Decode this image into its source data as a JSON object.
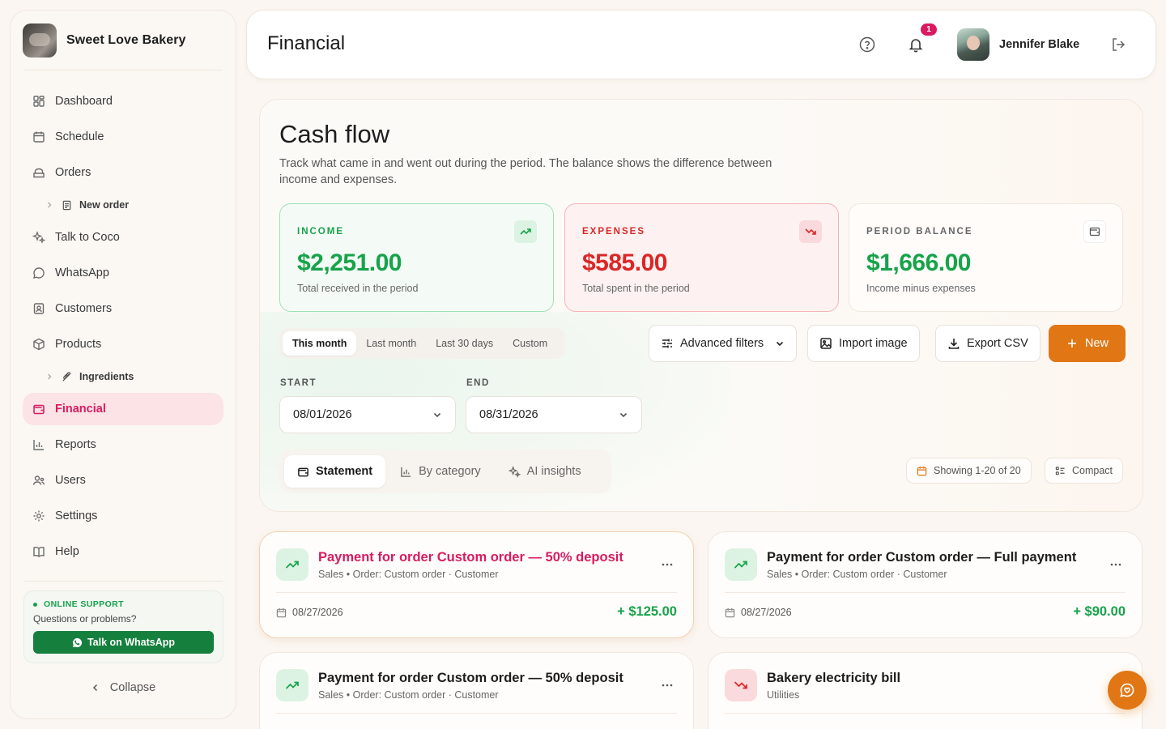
{
  "brand": {
    "name": "Sweet Love Bakery"
  },
  "sidebar": {
    "items": [
      {
        "label": "Dashboard",
        "icon": "dashboard-icon"
      },
      {
        "label": "Schedule",
        "icon": "calendar-icon"
      },
      {
        "label": "Orders",
        "icon": "orders-icon"
      },
      {
        "label": "New order",
        "icon": "document-icon",
        "sub": true
      },
      {
        "label": "Talk to Coco",
        "icon": "sparkles-icon"
      },
      {
        "label": "WhatsApp",
        "icon": "chat-bubble-icon"
      },
      {
        "label": "Customers",
        "icon": "contact-icon"
      },
      {
        "label": "Products",
        "icon": "box-icon"
      },
      {
        "label": "Ingredients",
        "icon": "wheat-icon",
        "sub": true
      },
      {
        "label": "Financial",
        "icon": "wallet-icon",
        "active": true
      },
      {
        "label": "Reports",
        "icon": "bar-chart-icon"
      },
      {
        "label": "Users",
        "icon": "users-icon"
      },
      {
        "label": "Settings",
        "icon": "gear-icon"
      },
      {
        "label": "Help",
        "icon": "book-icon"
      }
    ],
    "support": {
      "tag": "ONLINE SUPPORT",
      "question": "Questions or problems?",
      "button": "Talk on WhatsApp"
    },
    "collapse": "Collapse"
  },
  "header": {
    "title": "Financial",
    "notifications": "1",
    "user_name": "Jennifer Blake"
  },
  "cashflow": {
    "title": "Cash flow",
    "description": "Track what came in and went out during the period. The balance shows the difference between income and expenses.",
    "income": {
      "label": "INCOME",
      "value": "$2,251.00",
      "sub": "Total received in the period"
    },
    "expenses": {
      "label": "EXPENSES",
      "value": "$585.00",
      "sub": "Total spent in the period"
    },
    "balance": {
      "label": "PERIOD BALANCE",
      "value": "$1,666.00",
      "sub": "Income minus expenses"
    },
    "periods": [
      "This month",
      "Last month",
      "Last 30 days",
      "Custom"
    ],
    "active_period": "This month",
    "actions": {
      "filters": "Advanced filters",
      "import": "Import image",
      "export": "Export CSV",
      "new": "New"
    },
    "start": {
      "label": "START",
      "value": "08/01/2026"
    },
    "end": {
      "label": "END",
      "value": "08/31/2026"
    },
    "views": [
      "Statement",
      "By category",
      "AI insights"
    ],
    "active_view": "Statement",
    "showing": "Showing 1-20 of 20",
    "compact": "Compact"
  },
  "transactions": [
    {
      "title": "Payment for order Custom order — 50% deposit",
      "category": "Sales",
      "meta": "• Order: Custom order · Customer",
      "date": "08/27/2026",
      "amount": "+ $125.00",
      "direction": "in",
      "highlighted": true
    },
    {
      "title": "Payment for order Custom order — Full payment",
      "category": "Sales",
      "meta": "• Order: Custom order · Customer",
      "date": "08/27/2026",
      "amount": "+ $90.00",
      "direction": "in"
    },
    {
      "title": "Payment for order Custom order — 50% deposit",
      "category": "Sales",
      "meta": "• Order: Custom order · Customer",
      "direction": "in"
    },
    {
      "title": "Bakery electricity bill",
      "category": "Utilities",
      "meta": "",
      "direction": "out"
    }
  ],
  "colors": {
    "accent": "#e07714",
    "active_nav": "#d81b60",
    "income": "#16a34a",
    "expense": "#dc2626"
  }
}
